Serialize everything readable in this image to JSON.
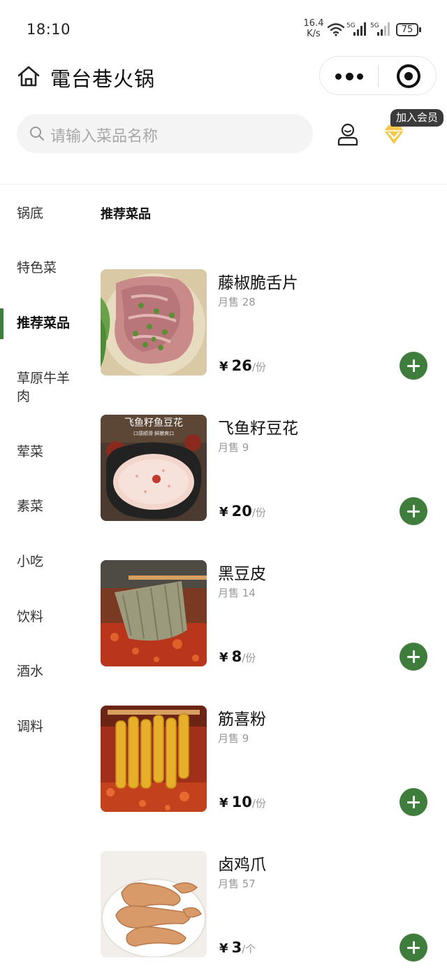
{
  "status_bar": {
    "time": "18:10",
    "net_speed_value": "16.4",
    "net_speed_unit": "K/s",
    "signal_1_label": "5G",
    "signal_2_label": "5G",
    "battery": "75"
  },
  "nav": {
    "title": "電台巷火锅"
  },
  "search": {
    "placeholder": "请输入菜品名称"
  },
  "member": {
    "badge": "加入会员"
  },
  "categories": [
    {
      "label": "锅底"
    },
    {
      "label": "特色菜"
    },
    {
      "label": "推荐菜品",
      "active": true
    },
    {
      "label": "草原牛羊肉"
    },
    {
      "label": "荤菜"
    },
    {
      "label": "素菜"
    },
    {
      "label": "小吃"
    },
    {
      "label": "饮料"
    },
    {
      "label": "酒水"
    },
    {
      "label": "调料"
    }
  ],
  "section_title": "推荐菜品",
  "products": [
    {
      "name": "藤椒脆舌片",
      "sales": "月售 28",
      "currency": "¥",
      "price": "26",
      "unit": "/份"
    },
    {
      "name": "飞鱼籽豆花",
      "sales": "月售 9",
      "currency": "¥",
      "price": "20",
      "unit": "/份",
      "image_text": "飞鱼籽鱼豆花",
      "image_subtext": "口感顺滑 鲜嫩爽口"
    },
    {
      "name": "黑豆皮",
      "sales": "月售 14",
      "currency": "¥",
      "price": "8",
      "unit": "/份"
    },
    {
      "name": "筋喜粉",
      "sales": "月售 9",
      "currency": "¥",
      "price": "10",
      "unit": "/份"
    },
    {
      "name": "卤鸡爪",
      "sales": "月售 57",
      "currency": "¥",
      "price": "3",
      "unit": "/个"
    }
  ],
  "colors": {
    "accent_green": "#3f7d3c",
    "member_gold": "#f2c94c"
  },
  "icons": {
    "home": "home-icon",
    "more": "more-dots-icon",
    "close": "target-circle-icon",
    "search": "search-icon",
    "user": "user-icon",
    "member": "diamond-icon",
    "add": "plus-circle-icon"
  }
}
